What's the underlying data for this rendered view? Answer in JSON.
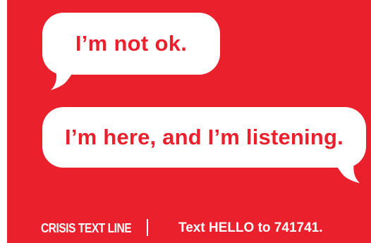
{
  "colors": {
    "background": "#ea202c",
    "bubble": "#ffffff",
    "bubble_text": "#ea202c",
    "footer_text": "#ffffff"
  },
  "bubbles": [
    {
      "text": "I’m not ok."
    },
    {
      "text": "I’m here, and I’m listening."
    }
  ],
  "footer": {
    "brand": "CRISIS TEXT LINE",
    "cta": "Text HELLO to 741741."
  }
}
